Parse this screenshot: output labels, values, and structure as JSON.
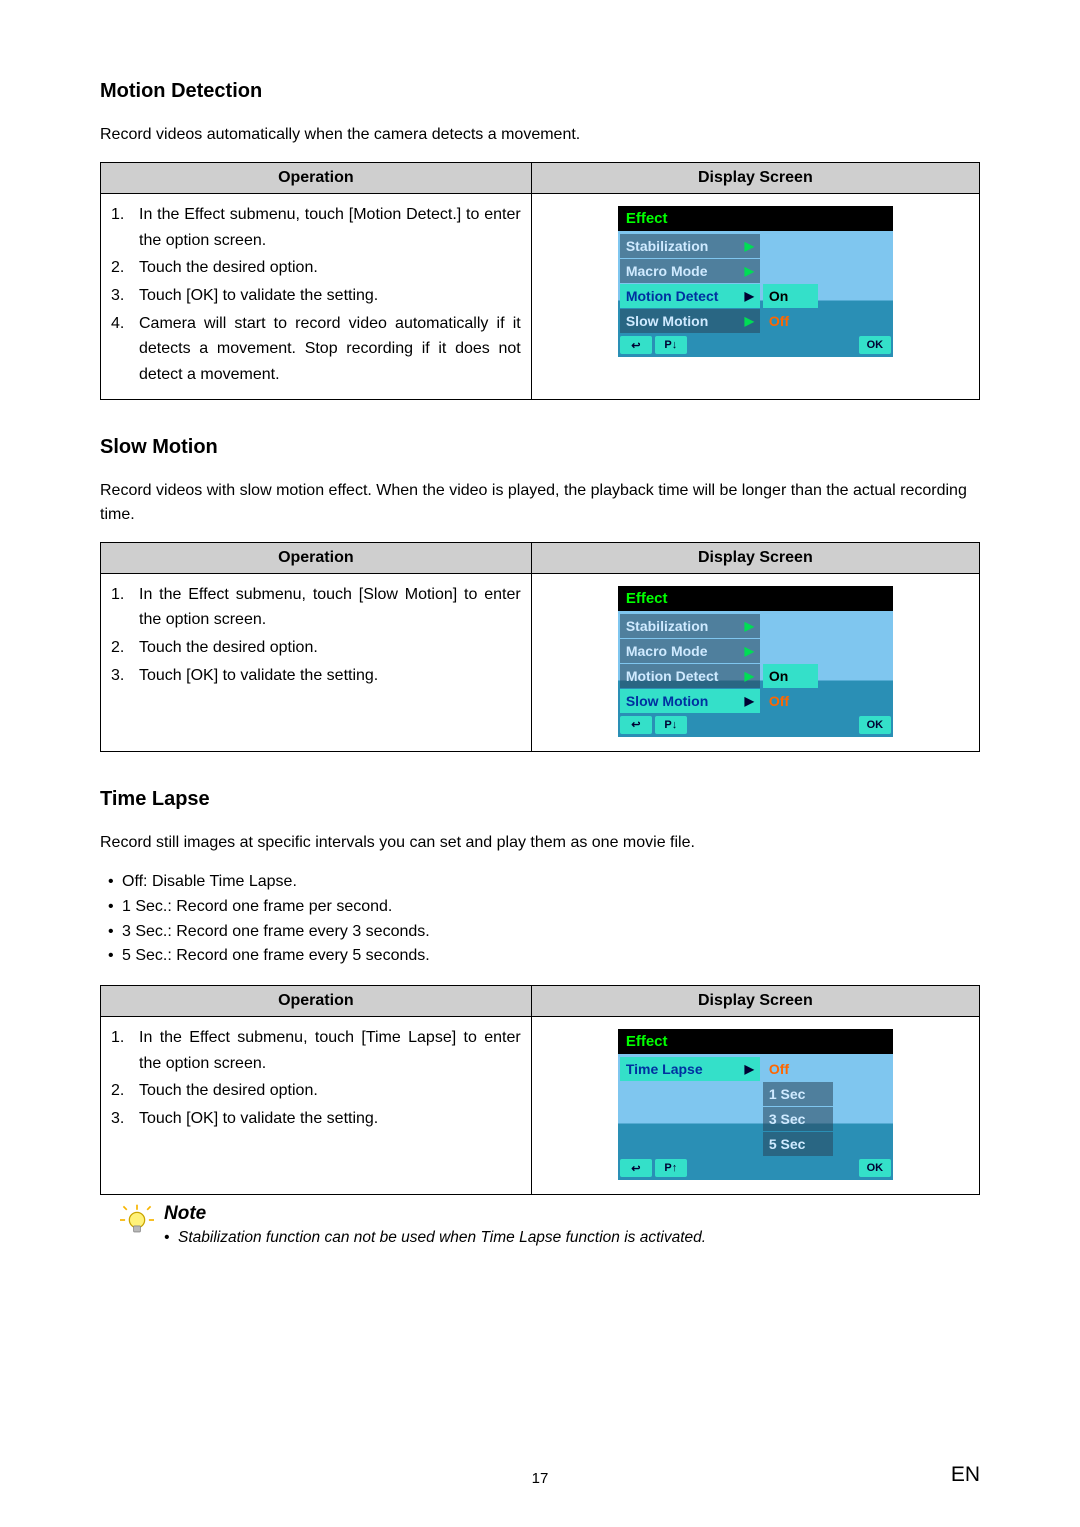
{
  "page_number": "17",
  "page_lang": "EN",
  "table_headers": {
    "operation": "Operation",
    "display": "Display Screen"
  },
  "sections": [
    {
      "id": "motion",
      "title": "Motion Detection",
      "intro": "Record videos automatically when the camera detects a movement.",
      "bullets": [],
      "steps": [
        "In the Effect submenu, touch [Motion Detect.] to enter the option screen.",
        "Touch the desired option.",
        "Touch [OK] to validate the setting.",
        "Camera will start to record video automatically if it detects a movement. Stop recording if it does not detect a movement."
      ],
      "screen": {
        "header": "Effect",
        "rows": [
          {
            "label": "Stabilization",
            "selected": false,
            "value": "",
            "value_style": ""
          },
          {
            "label": "Macro Mode",
            "selected": false,
            "value": "",
            "value_style": ""
          },
          {
            "label": "Motion Detect",
            "selected": true,
            "value": "On",
            "value_style": "highlight"
          },
          {
            "label": "Slow Motion",
            "selected": false,
            "value": "Off",
            "value_style": "orange"
          }
        ],
        "footer": {
          "back": "↩",
          "scroll": "P↓",
          "ok": "OK"
        }
      }
    },
    {
      "id": "slow",
      "title": "Slow Motion",
      "intro": "Record videos with slow motion effect. When the video is played, the playback time will be longer than the actual recording time.",
      "bullets": [],
      "steps": [
        "In the Effect submenu, touch [Slow Motion] to enter the option screen.",
        "Touch the desired option.",
        "Touch [OK] to validate the setting."
      ],
      "screen": {
        "header": "Effect",
        "rows": [
          {
            "label": "Stabilization",
            "selected": false,
            "value": "",
            "value_style": ""
          },
          {
            "label": "Macro Mode",
            "selected": false,
            "value": "",
            "value_style": ""
          },
          {
            "label": "Motion Detect",
            "selected": false,
            "value": "On",
            "value_style": "highlight"
          },
          {
            "label": "Slow Motion",
            "selected": true,
            "value": "Off",
            "value_style": "orange"
          }
        ],
        "footer": {
          "back": "↩",
          "scroll": "P↓",
          "ok": "OK"
        }
      }
    },
    {
      "id": "timelapse",
      "title": "Time Lapse",
      "intro": "Record still images at specific intervals you can set and play them as one movie file.",
      "bullets": [
        "Off: Disable Time Lapse.",
        "1 Sec.: Record one frame per second.",
        "3 Sec.: Record one frame every 3 seconds.",
        "5 Sec.: Record one frame every 5 seconds."
      ],
      "steps": [
        "In the Effect submenu, touch [Time Lapse] to enter the option screen.",
        "Touch the desired option.",
        "Touch [OK] to validate the setting."
      ],
      "screen": {
        "header": "Effect",
        "rows": [
          {
            "label": "Time Lapse",
            "selected": true,
            "value": "Off",
            "value_style": "orange"
          },
          {
            "label": "",
            "selected": false,
            "value": "1 Sec",
            "value_style": "opt"
          },
          {
            "label": "",
            "selected": false,
            "value": "3 Sec",
            "value_style": "opt"
          },
          {
            "label": "",
            "selected": false,
            "value": "5 Sec",
            "value_style": "opt"
          }
        ],
        "footer": {
          "back": "↩",
          "scroll": "P↑",
          "ok": "OK"
        }
      }
    }
  ],
  "note": {
    "title": "Note",
    "text": "Stabilization function can not be used when Time Lapse function is activated."
  }
}
